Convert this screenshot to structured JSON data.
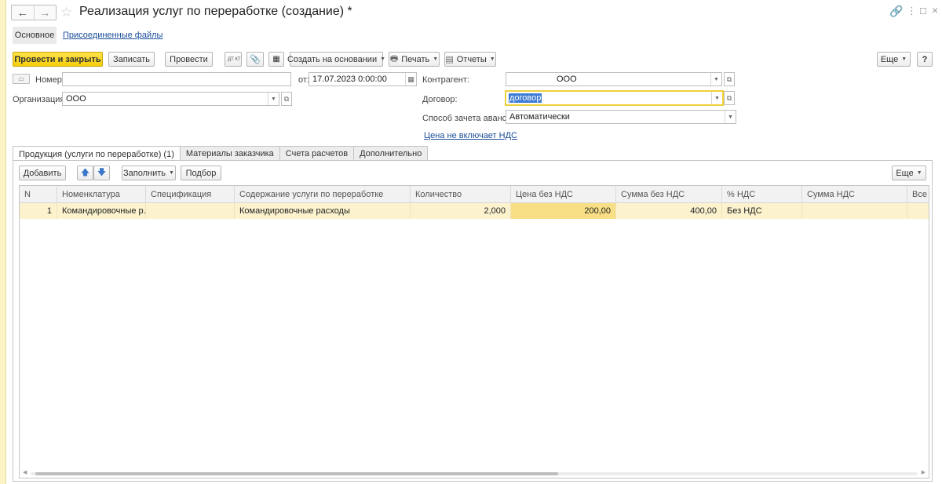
{
  "window": {
    "title": "Реализация услуг по переработке (создание) *"
  },
  "sections": {
    "main": "Основное",
    "files": "Присоединенные файлы"
  },
  "toolbar": {
    "post_close": "Провести и закрыть",
    "save": "Записать",
    "post": "Провести",
    "dtkt_icon_text": "ДТ КТ",
    "create_based": "Создать на основании",
    "print": "Печать",
    "reports": "Отчеты",
    "more": "Еще",
    "help": "?"
  },
  "form": {
    "number_label": "Номер:",
    "number_value": "",
    "date_label": "от:",
    "date_value": "17.07.2023  0:00:00",
    "org_label": "Организация:",
    "org_value": "ООО",
    "counterparty_label": "Контрагент:",
    "counterparty_value": "ООО",
    "contract_label": "Договор:",
    "contract_value": "договор",
    "advance_label": "Способ зачета авансов:",
    "advance_value": "Автоматически",
    "vat_link": "Цена не включает НДС"
  },
  "tabs": [
    {
      "label": "Продукция (услуги по переработке) (1)"
    },
    {
      "label": "Материалы заказчика"
    },
    {
      "label": "Счета расчетов"
    },
    {
      "label": "Дополнительно"
    }
  ],
  "table_toolbar": {
    "add": "Добавить",
    "fill": "Заполнить",
    "pick": "Подбор",
    "more": "Еще"
  },
  "table": {
    "columns": [
      "N",
      "Номенклатура",
      "Спецификация",
      "Содержание услуги по переработке",
      "Количество",
      "Цена без НДС",
      "Сумма без НДС",
      "% НДС",
      "Сумма НДС",
      "Все"
    ],
    "rows": [
      [
        "1",
        "Командировочные р...",
        "",
        "Командировочные расходы",
        "2,000",
        "200,00",
        "400,00",
        "Без НДС",
        "",
        ""
      ]
    ]
  },
  "colors": {
    "primary": "#f5cd0c",
    "selected_row": "#fcf3ce",
    "link": "#1a4d99",
    "focus": "#f0cf3c"
  }
}
